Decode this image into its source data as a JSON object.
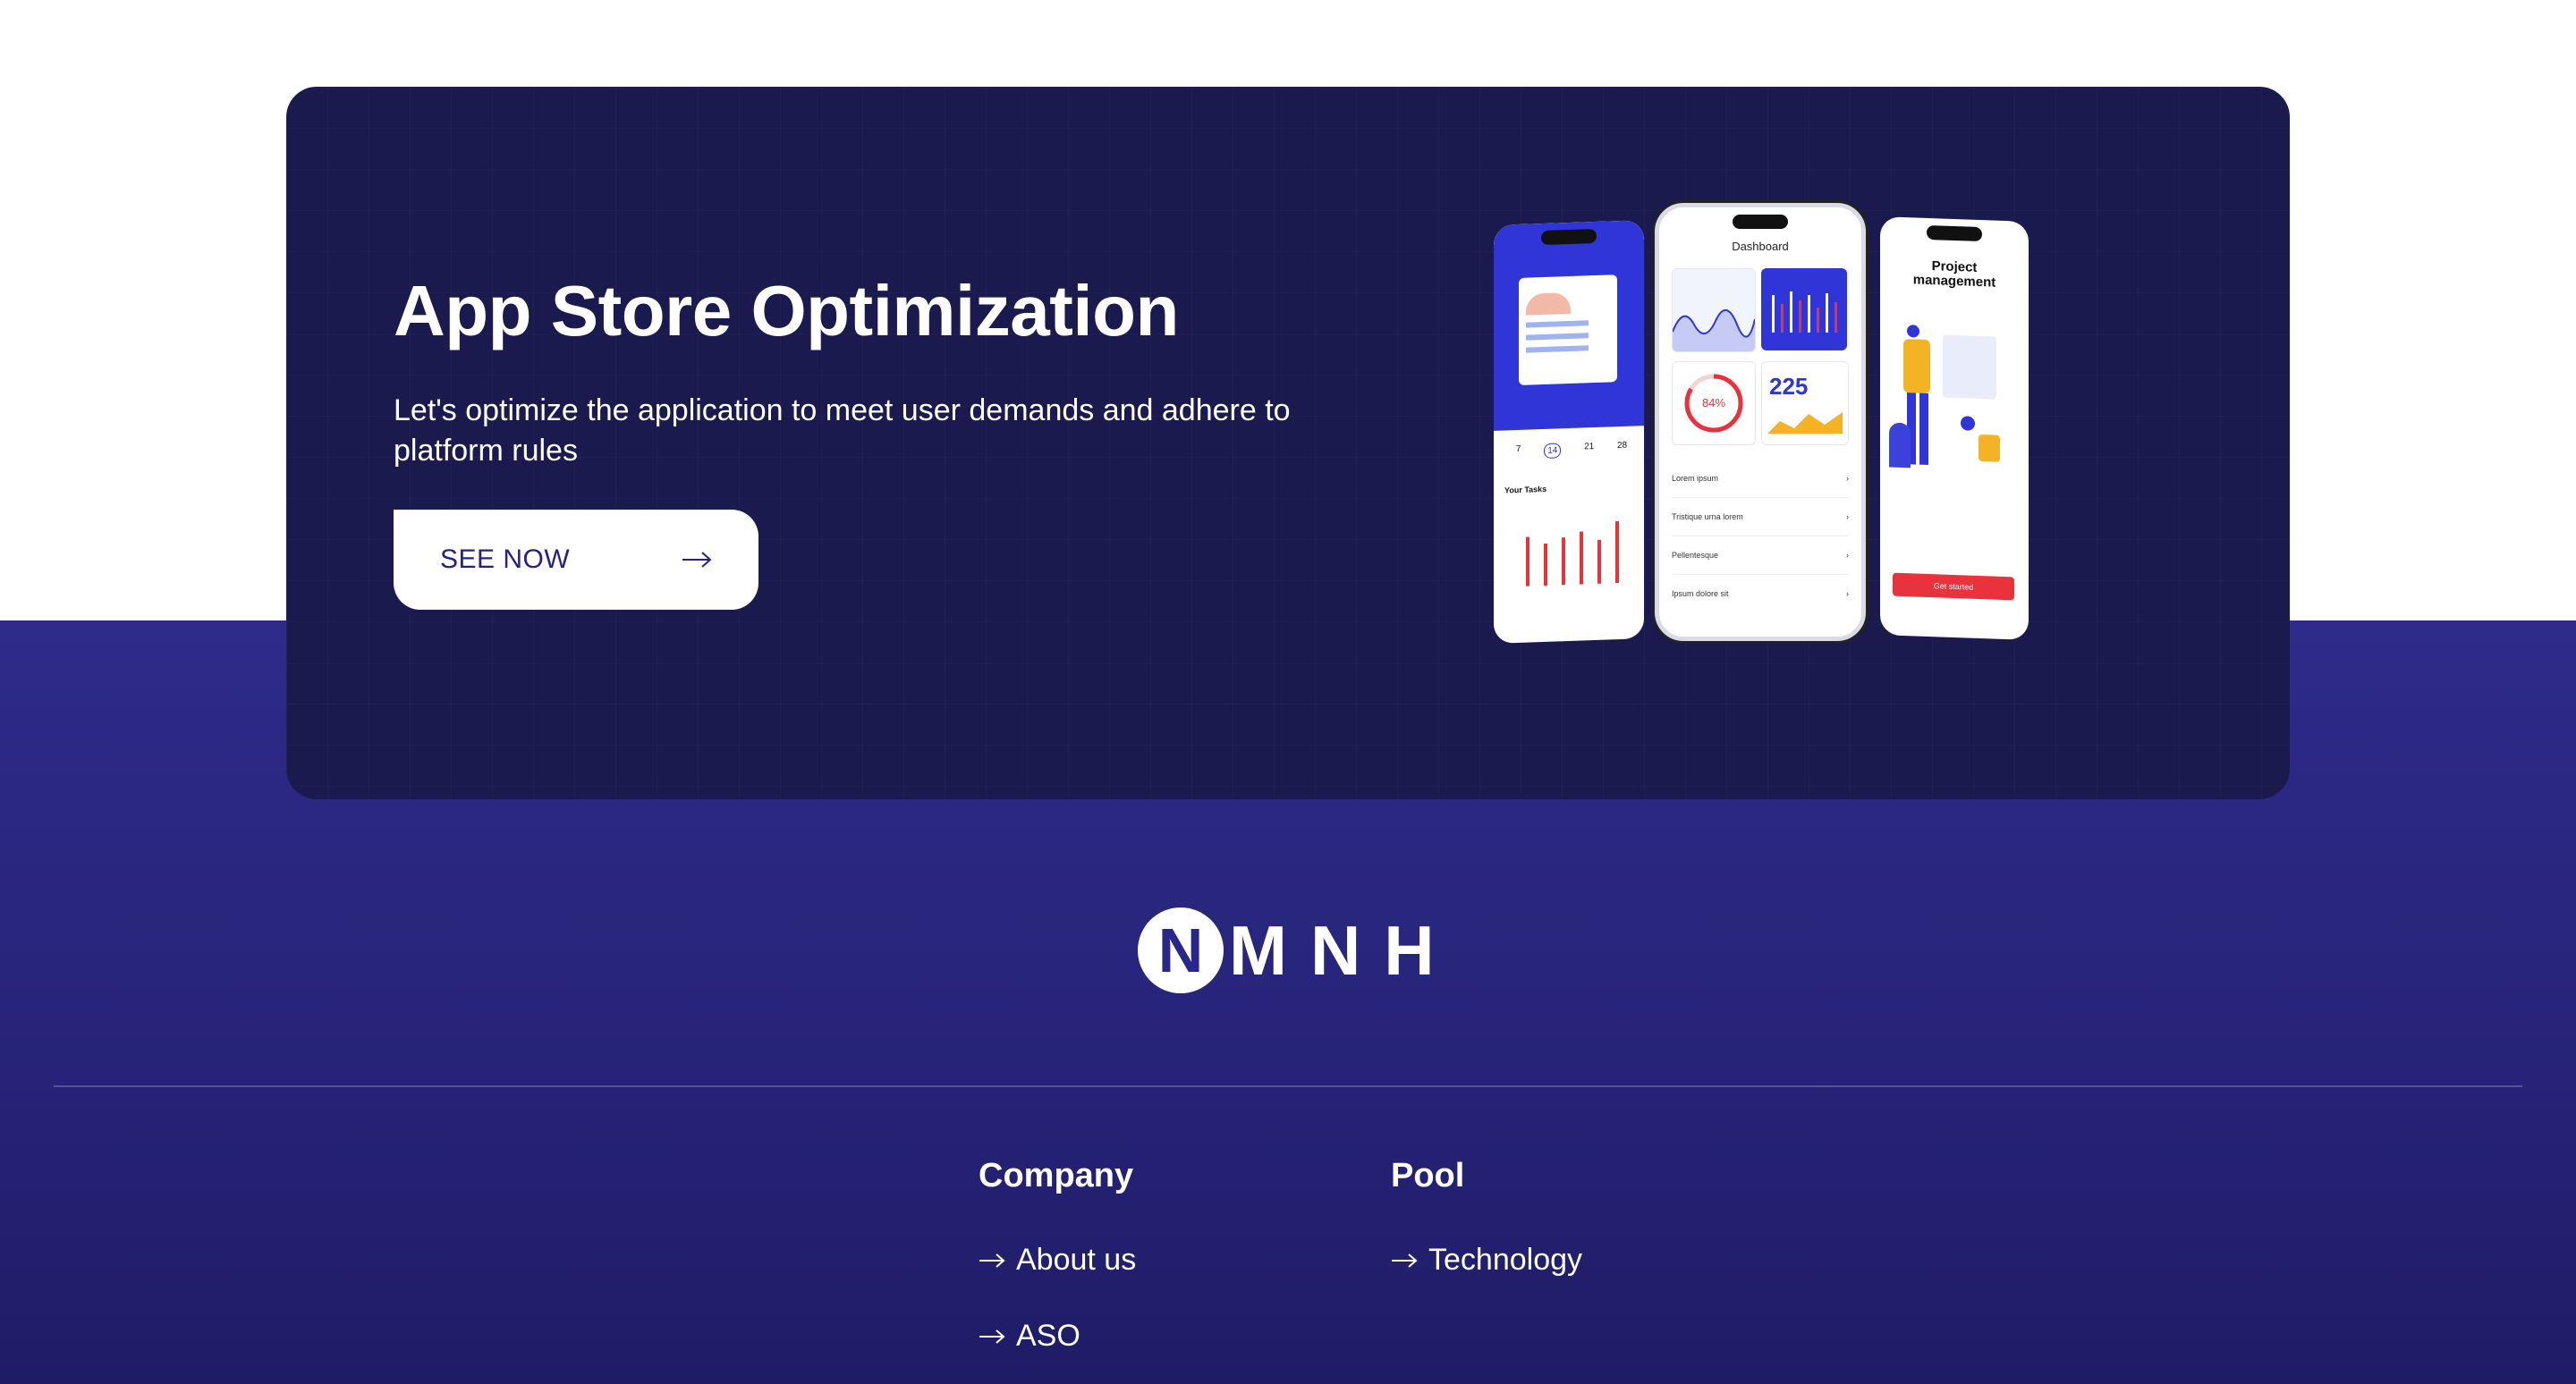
{
  "banner": {
    "title": "App Store Optimization",
    "description": "Let's optimize the application to meet user demands and adhere to platform rules",
    "button_label": "SEE NOW"
  },
  "mockups": {
    "dashboard_title": "Dashboard",
    "dashboard_percent": "84%",
    "dashboard_number": "225",
    "dashboard_list": [
      "Lorem ipsum",
      "Tristique urna lorem",
      "Pellentesque",
      "Ipsum dolore sit"
    ],
    "calendar_days": [
      "7",
      "14",
      "21",
      "28"
    ],
    "tasks_label": "Your Tasks",
    "project_title": "Project management",
    "project_button": "Get started"
  },
  "logo": {
    "circle_letter": "N",
    "letters": "MNH"
  },
  "footer": {
    "company": {
      "title": "Company",
      "links": [
        "About us",
        "ASO"
      ]
    },
    "pool": {
      "title": "Pool",
      "links": [
        "Technology"
      ]
    }
  },
  "colors": {
    "banner_bg": "#1b1a4e",
    "footer_bg": "#2e2b8a",
    "accent": "#24208a",
    "red": "#e8323c",
    "phone_blue": "#2f35d6"
  }
}
